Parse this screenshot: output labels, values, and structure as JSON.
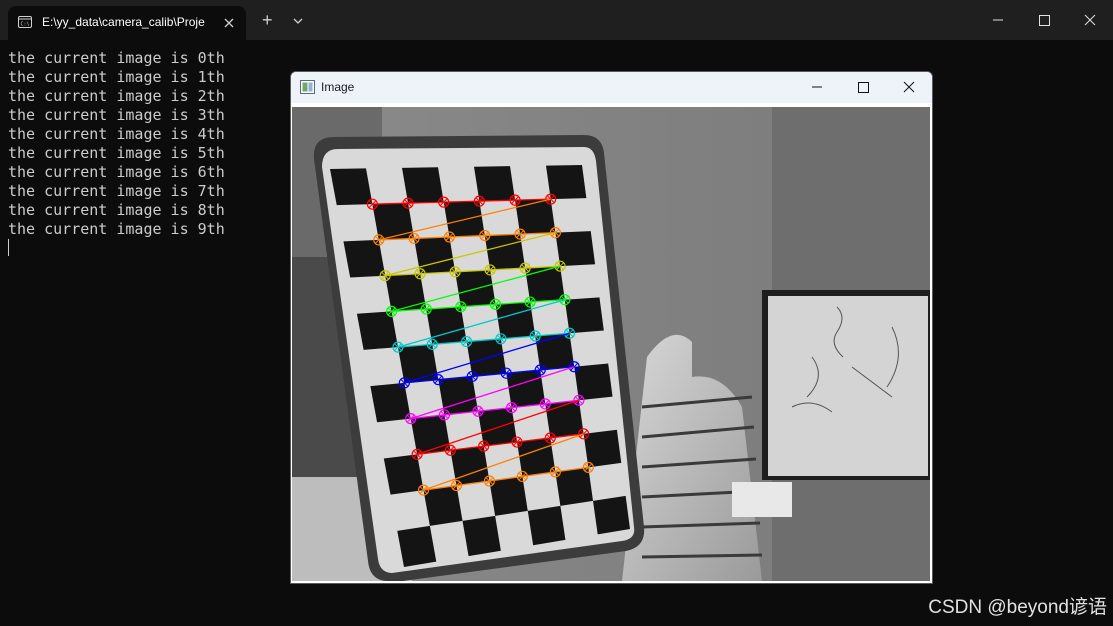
{
  "terminal": {
    "tab_title": "E:\\yy_data\\camera_calib\\Proje",
    "new_tab_symbol": "+",
    "lines": [
      "the current image is 0th",
      "the current image is 1th",
      "the current image is 2th",
      "the current image is 3th",
      "the current image is 4th",
      "the current image is 5th",
      "the current image is 6th",
      "the current image is 7th",
      "the current image is 8th",
      "the current image is 9th"
    ],
    "colors": {
      "background": "#0c0c0c",
      "tabbar": "#1f1f1f",
      "text": "#cccccc"
    }
  },
  "image_window": {
    "title": "Image",
    "corner_colors": [
      "#ff0000",
      "#ff8000",
      "#c8c800",
      "#00ff00",
      "#00c8c8",
      "#0000ff",
      "#ff00ff",
      "#ff0000",
      "#ff8000"
    ]
  },
  "watermark": "CSDN @beyond谚语"
}
